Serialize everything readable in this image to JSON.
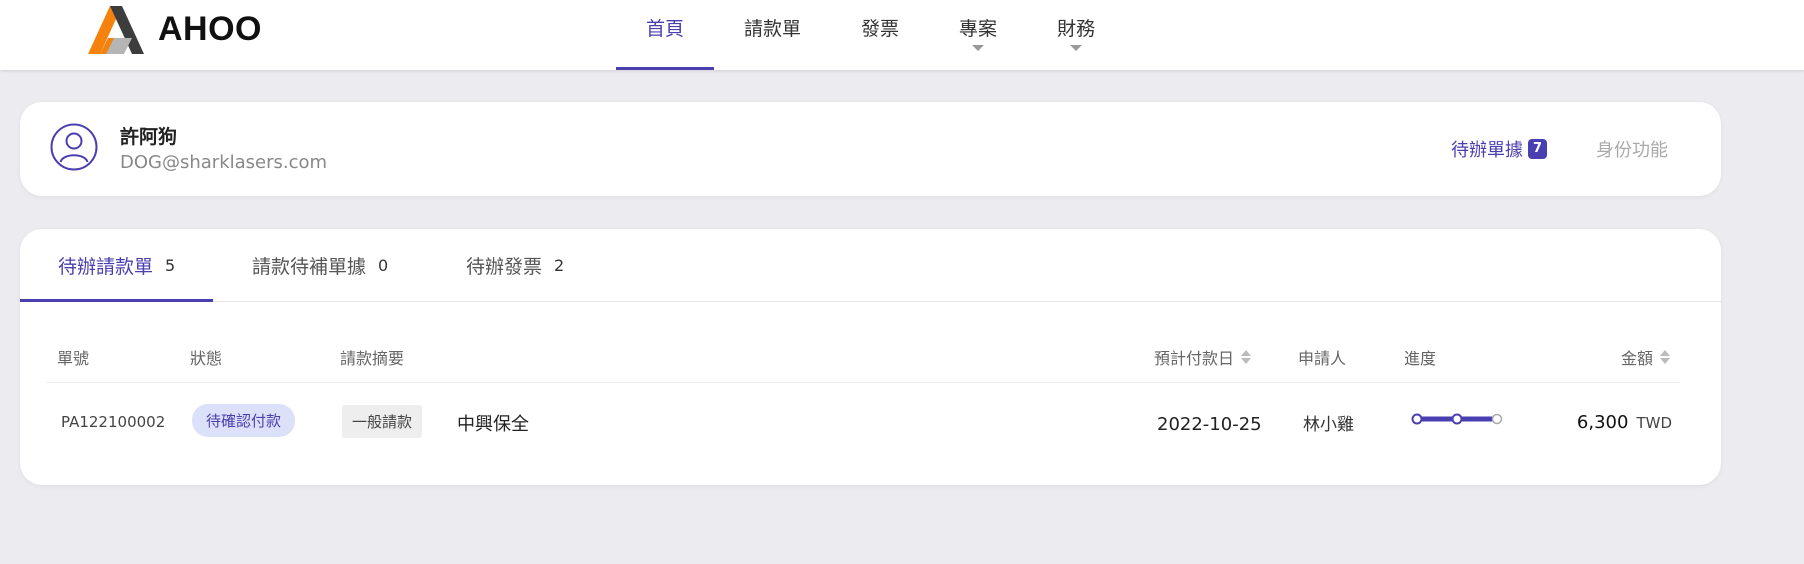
{
  "brand": {
    "name": "AHOO",
    "colors": {
      "orange": "#f5820d",
      "dark": "#444444",
      "gray": "#b5b5b5"
    }
  },
  "nav": {
    "items": [
      {
        "label": "首頁",
        "active": true
      },
      {
        "label": "請款單"
      },
      {
        "label": "發票"
      },
      {
        "label": "專案",
        "dropdown": true
      },
      {
        "label": "財務",
        "dropdown": true
      }
    ]
  },
  "profile": {
    "name": "許阿狗",
    "email": "DOG@sharklasers.com",
    "pending_label": "待辦單據",
    "pending_count": "7",
    "role_label": "身份功能"
  },
  "tabs": [
    {
      "label": "待辦請款單",
      "count": "5",
      "active": true
    },
    {
      "label": "請款待補單據",
      "count": "0"
    },
    {
      "label": "待辦發票",
      "count": "2"
    }
  ],
  "table": {
    "columns": {
      "number": "單號",
      "status": "狀態",
      "summary": "請款摘要",
      "pay_date": "預計付款日",
      "applicant": "申請人",
      "progress": "進度",
      "amount": "金額"
    },
    "rows": [
      {
        "number": "PA122100002",
        "status": "待確認付款",
        "type": "一般請款",
        "summary": "中興保全",
        "pay_date": "2022-10-25",
        "applicant": "林小雞",
        "progress_steps_done": 2,
        "progress_steps_total": 3,
        "amount": "6,300",
        "currency": "TWD"
      }
    ]
  },
  "accent_color": "#4a3fb0"
}
